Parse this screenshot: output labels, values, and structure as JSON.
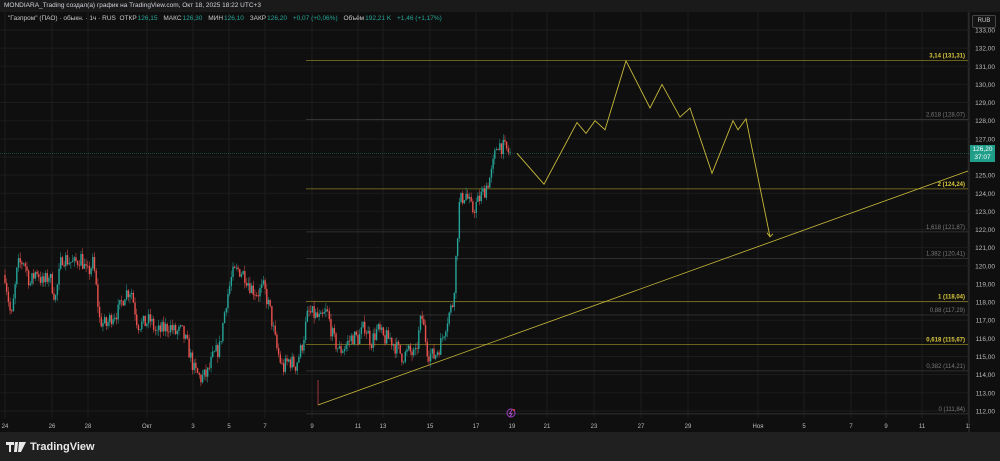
{
  "header": {
    "title": "MONDIARA_Trading создал(а) график на TradingView.com, Окт 18, 2025 18:22 UTC+3"
  },
  "legend": {
    "symbol": "\"Газпром\" (ПАО) · обыкн. · 1ч · RUS",
    "open_label": "ОТКР",
    "open": "126,15",
    "high_label": "МАКС",
    "high": "126,30",
    "low_label": "МИН",
    "low": "126,10",
    "close_label": "ЗАКР",
    "close": "126,20",
    "change": "+0,07 (+0,06%)",
    "volume_label": "Объём",
    "volume": "192,21 K",
    "volume_change": "+1,46 (+1,17%)"
  },
  "currency": "RUB",
  "current_price": {
    "price": "126,20",
    "countdown": "37:07",
    "color": "#1f9e89"
  },
  "footer": {
    "brand": "TradingView"
  },
  "colors": {
    "up": "#26a69a",
    "down": "#ef5350",
    "fib_major": "#d8c73c",
    "fib_minor": "#7a7a7a",
    "drawing": "#c8b93a"
  },
  "chart_data": {
    "type": "candlestick",
    "ylim": [
      112,
      133
    ],
    "y_ticks": [
      "133,00",
      "132,00",
      "131,00",
      "130,00",
      "129,00",
      "128,00",
      "127,00",
      "126,00",
      "125,00",
      "124,00",
      "123,00",
      "122,00",
      "121,00",
      "120,00",
      "119,00",
      "118,00",
      "117,00",
      "116,00",
      "115,00",
      "114,00",
      "113,00",
      "112,00"
    ],
    "x_ticks": [
      "24",
      "26",
      "28",
      "Окт",
      "3",
      "5",
      "7",
      "9",
      "11",
      "13",
      "15",
      "17",
      "19",
      "21",
      "23",
      "27",
      "29",
      "Ноя",
      "5",
      "7",
      "9",
      "11",
      "1:"
    ],
    "fib_levels": [
      {
        "label": "3,14 (131,31)",
        "price": 131.31,
        "major": true
      },
      {
        "label": "2,618 (128,07)",
        "price": 128.07,
        "major": false
      },
      {
        "label": "2 (124,24)",
        "price": 124.24,
        "major": true
      },
      {
        "label": "1,618 (121,87)",
        "price": 121.87,
        "major": false
      },
      {
        "label": "1,382 (120,41)",
        "price": 120.41,
        "major": false
      },
      {
        "label": "1 (118,04)",
        "price": 118.04,
        "major": true
      },
      {
        "label": "0,88 (117,29)",
        "price": 117.29,
        "major": false
      },
      {
        "label": "0,618 (115,67)",
        "price": 115.67,
        "major": true
      },
      {
        "label": "0,382 (114,21)",
        "price": 114.21,
        "major": false
      },
      {
        "label": "0 (111,84)",
        "price": 111.84,
        "major": false
      }
    ],
    "price_path": [
      119.5,
      117,
      120,
      120.3,
      119,
      119.8,
      119,
      119.5,
      118.2,
      120.5,
      120.3,
      120.1,
      120.5,
      119.5,
      120.2,
      117,
      116.7,
      117.3,
      117.5,
      118.5,
      118.7,
      116.8,
      116.8,
      117,
      116.3,
      116.5,
      116.7,
      116.3,
      116.4,
      115.5,
      114.2,
      113.8,
      114,
      115,
      115.5,
      118,
      119.5,
      119.8,
      119.5,
      118.8,
      118.5,
      118.8,
      117.5,
      115.5,
      114.3,
      114.8,
      114.5,
      115.5,
      117.4,
      117.3,
      117,
      117.5,
      116,
      115.3,
      115.6,
      116.1,
      116,
      116.7,
      115.8,
      116.5,
      116,
      116,
      115.5,
      115,
      115.3,
      115,
      117.3,
      115.2,
      115,
      115.7,
      117,
      118,
      123.5,
      124,
      123,
      123.6,
      124.2,
      125,
      126.8,
      126.5,
      126.2
    ],
    "projection_path": [
      126.2,
      124.5,
      127.9,
      127.3,
      128,
      127.5,
      131.3,
      128.7,
      130,
      128.2,
      128.7,
      125.1,
      128,
      127.5,
      128.1,
      121.6
    ]
  }
}
